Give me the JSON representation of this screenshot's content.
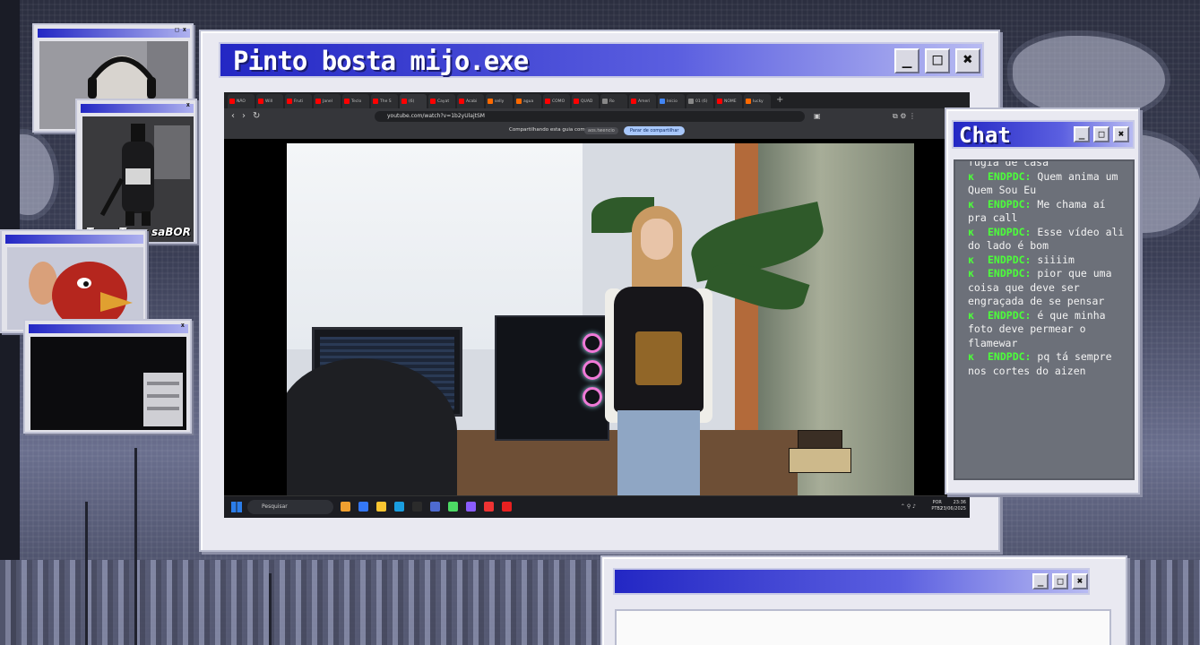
{
  "main_window": {
    "title": "Pinto bosta mijo.exe",
    "buttons": {
      "minimize": "_",
      "maximize": "□",
      "close": "✖"
    }
  },
  "browser": {
    "tabs": [
      {
        "label": "NÃO ",
        "color": "#ff0000"
      },
      {
        "label": "Will ",
        "color": "#ff0000"
      },
      {
        "label": "Fruti",
        "color": "#ff0000"
      },
      {
        "label": "Janel",
        "color": "#ff0000"
      },
      {
        "label": "Teclo",
        "color": "#ff0000"
      },
      {
        "label": "The S",
        "color": "#ff0000"
      },
      {
        "label": "(6)",
        "color": "#ff0000",
        "active": true
      },
      {
        "label": "Cayat",
        "color": "#ff0000"
      },
      {
        "label": "Acabi",
        "color": "#ff0000"
      },
      {
        "label": "selly",
        "color": "#ff6a00"
      },
      {
        "label": "agua",
        "color": "#ff6a00"
      },
      {
        "label": "COMO",
        "color": "#ff0000"
      },
      {
        "label": "QUAD",
        "color": "#ff0000"
      },
      {
        "label": "Ro",
        "color": "#888888"
      },
      {
        "label": "Ameri",
        "color": "#ff0000"
      },
      {
        "label": "Início",
        "color": "#4285f4"
      },
      {
        "label": "01 (6)",
        "color": "#888888"
      },
      {
        "label": "NOME",
        "color": "#ff0000"
      },
      {
        "label": "lucky",
        "color": "#ff6a00"
      }
    ],
    "url": "youtube.com/watch?v=1b2yUlajtSM",
    "share_text": "Compartilhando esta guia com",
    "share_chip": "aos.twencio",
    "share_stop": "Parar de compartilhar"
  },
  "taskbar": {
    "search_placeholder": "Pesquisar",
    "lang_line1": "POR",
    "lang_line2": "PTB2",
    "time": "23:36",
    "date": "23/06/2025",
    "apps": [
      "#f0a030",
      "#3478f6",
      "#f9c531",
      "#1a9ee0",
      "#2b2b2b",
      "#4e6bd1",
      "#4cd964",
      "#8a5cff",
      "#e33",
      "#e82020"
    ]
  },
  "cams": {
    "cam2_caption": "Tung Tung saBOR",
    "close_glyph": "x",
    "cam1_glyphs": "□ x"
  },
  "chat": {
    "title": "Chat",
    "partial_top": "fugia de casa",
    "messages": [
      {
        "user": "ENDPDC:",
        "text": "Quem anima um Quem Sou Eu"
      },
      {
        "user": "ENDPDC:",
        "text": "Me chama aí pra call"
      },
      {
        "user": "ENDPDC:",
        "text": "Esse vídeo ali do lado é bom"
      },
      {
        "user": "ENDPDC:",
        "text": "siiiim"
      },
      {
        "user": "ENDPDC:",
        "text": "pior que uma coisa que deve ser engraçada de se pensar"
      },
      {
        "user": "ENDPDC:",
        "text": "é que minha foto deve permear o flamewar"
      },
      {
        "user": "ENDPDC:",
        "text": "pq tá sempre nos cortes do aizen"
      }
    ],
    "bullet": "ĸ"
  }
}
